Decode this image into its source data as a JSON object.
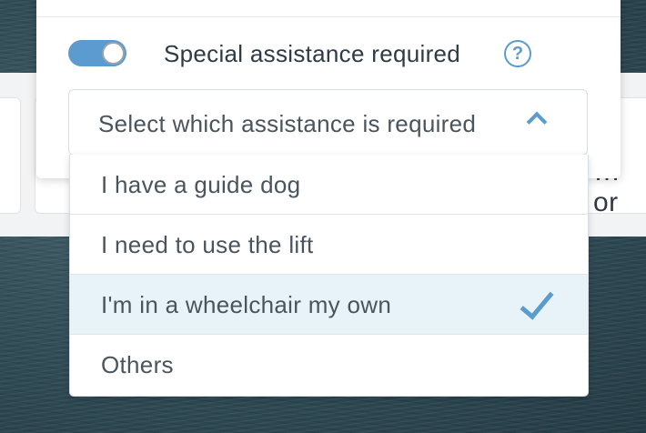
{
  "background": {
    "partial_text": "…or"
  },
  "toggle": {
    "label": "Special assistance required",
    "state": "on",
    "help_icon": "?"
  },
  "select": {
    "placeholder": "Select which assistance is required",
    "expanded": true
  },
  "options": [
    {
      "label": "I have a guide dog",
      "selected": false
    },
    {
      "label": "I need to use the lift",
      "selected": false
    },
    {
      "label": "I'm in a wheelchair my own",
      "selected": true
    },
    {
      "label": "Others",
      "selected": false
    }
  ],
  "colors": {
    "accent": "#5b9bcf",
    "selected_bg": "#e8f3f9",
    "text": "#2f3a44"
  },
  "icons": {
    "help": "question-circle-icon",
    "chevron": "chevron-up-icon",
    "check": "check-icon"
  }
}
